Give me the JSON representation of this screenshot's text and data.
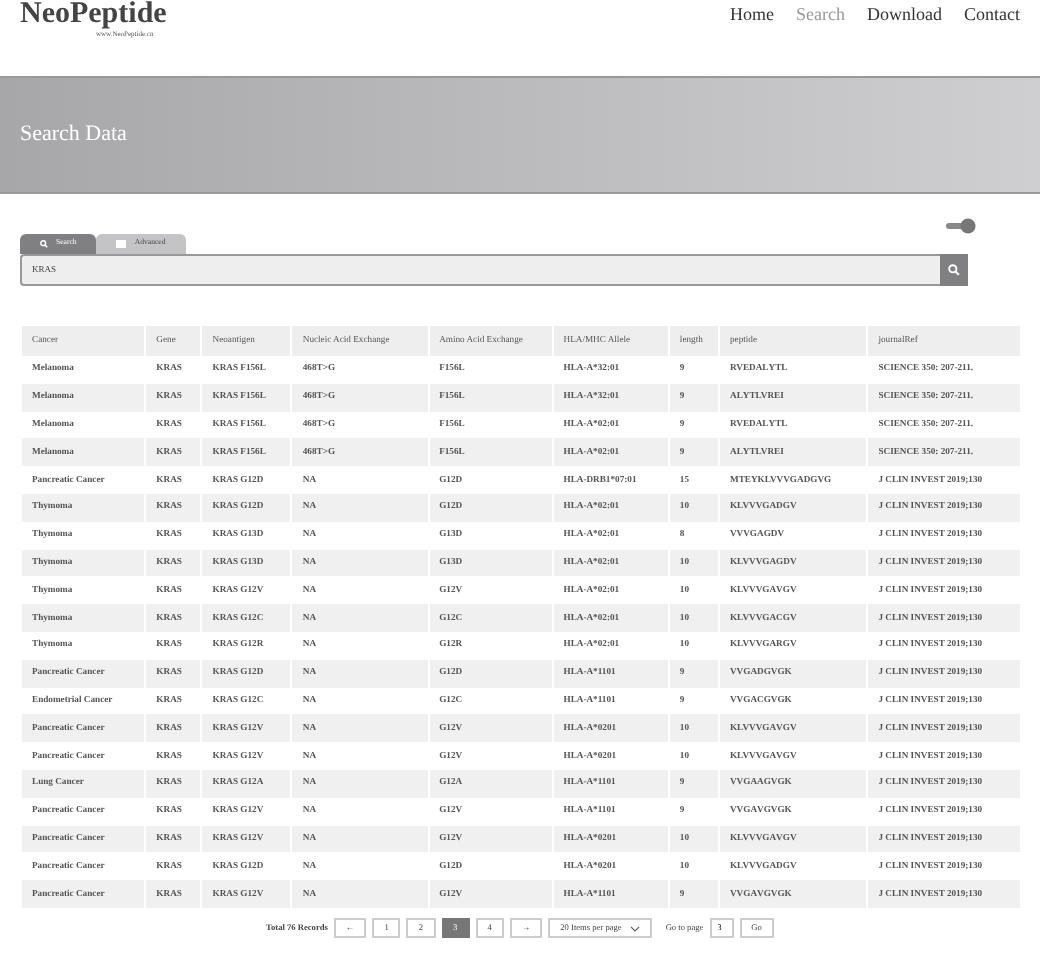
{
  "brand": {
    "title": "NeoPeptide",
    "subtitle": "www.NeoPeptide.cn"
  },
  "nav": [
    {
      "label": "Home",
      "selected": false
    },
    {
      "label": "Search",
      "selected": true
    },
    {
      "label": "Download",
      "selected": false
    },
    {
      "label": "Contact",
      "selected": false
    }
  ],
  "banner": {
    "title": "Search Data"
  },
  "switch": {
    "on": true
  },
  "tabs": [
    {
      "label": "Search",
      "selected": true,
      "kind": "search"
    },
    {
      "label": "Advanced",
      "selected": false,
      "kind": "table"
    }
  ],
  "search": {
    "value": "KRAS"
  },
  "table": {
    "columns": [
      "Cancer",
      "Gene",
      "Neoantigen",
      "Nucleic Acid Exchange",
      "Amino Acid Exchange",
      "HLA/MHC Allele",
      "length",
      "peptide",
      "journalRef"
    ],
    "rows": [
      [
        "Melanoma",
        "KRAS",
        "KRAS F156L",
        "468T>G",
        "F156L",
        "HLA-A*32:01",
        "9",
        "RVEDA**L**YTL",
        "SCIENCE 350: 207-211."
      ],
      [
        "Melanoma",
        "KRAS",
        "KRAS F156L",
        "468T>G",
        "F156L",
        "HLA-A*32:01",
        "9",
        "A**L**YTLVREI",
        "SCIENCE 350: 207-211."
      ],
      [
        "Melanoma",
        "KRAS",
        "KRAS F156L",
        "468T>G",
        "F156L",
        "HLA-A*02:01",
        "9",
        "RVEDA**L**YTL",
        "SCIENCE 350: 207-211."
      ],
      [
        "Melanoma",
        "KRAS",
        "KRAS F156L",
        "468T>G",
        "F156L",
        "HLA-A*02:01",
        "9",
        "A**L**YTLVREI",
        "SCIENCE 350: 207-211."
      ],
      [
        "Pancreatic Cancer",
        "KRAS",
        "KRAS G12D",
        "NA",
        "G12D",
        "HLA-DRB1*07:01",
        "15",
        "MTEYKLVVVGA**D**GVG",
        "J CLIN INVEST 2019;130"
      ],
      [
        "Thymoma",
        "KRAS",
        "KRAS G12D",
        "NA",
        "G12D",
        "HLA-A*02:01",
        "10",
        "KLVVVGA**D**GV",
        "J CLIN INVEST 2019;130"
      ],
      [
        "Thymoma",
        "KRAS",
        "KRAS G13D",
        "NA",
        "G13D",
        "HLA-A*02:01",
        "8",
        "VVVGAG**D**V",
        "J CLIN INVEST 2019;130"
      ],
      [
        "Thymoma",
        "KRAS",
        "KRAS G13D",
        "NA",
        "G13D",
        "HLA-A*02:01",
        "10",
        "KLVVVGAG**D**V",
        "J CLIN INVEST 2019;130"
      ],
      [
        "Thymoma",
        "KRAS",
        "KRAS G12V",
        "NA",
        "G12V",
        "HLA-A*02:01",
        "10",
        "KLVVVGA**V**GV",
        "J CLIN INVEST 2019;130"
      ],
      [
        "Thymoma",
        "KRAS",
        "KRAS G12C",
        "NA",
        "G12C",
        "HLA-A*02:01",
        "10",
        "KLVVVGA**C**GV",
        "J CLIN INVEST 2019;130"
      ],
      [
        "Thymoma",
        "KRAS",
        "KRAS G12R",
        "NA",
        "G12R",
        "HLA-A*02:01",
        "10",
        "KLVVVGA**R**GV",
        "J CLIN INVEST 2019;130"
      ],
      [
        "Pancreatic Cancer",
        "KRAS",
        "KRAS G12D",
        "NA",
        "G12D",
        "HLA-A*1101",
        "9",
        "VVGA**D**GVGK",
        "J CLIN INVEST 2019;130"
      ],
      [
        "Endometrial Cancer",
        "KRAS",
        "KRAS G12C",
        "NA",
        "G12C",
        "HLA-A*1101",
        "9",
        "VVGA**C**GVGK",
        "J CLIN INVEST 2019;130"
      ],
      [
        "Pancreatic Cancer",
        "KRAS",
        "KRAS G12V",
        "NA",
        "G12V",
        "HLA-A*0201",
        "10",
        "KLVVVGA**V**GV",
        "J CLIN INVEST 2019;130"
      ],
      [
        "Pancreatic Cancer",
        "KRAS",
        "KRAS G12V",
        "NA",
        "G12V",
        "HLA-A*0201",
        "10",
        "KLVVVGA**V**GV",
        "J CLIN INVEST 2019;130"
      ],
      [
        "Lung Cancer",
        "KRAS",
        "KRAS G12A",
        "NA",
        "G12A",
        "HLA-A*1101",
        "9",
        "VVGA**A**GVGK",
        "J CLIN INVEST 2019;130"
      ],
      [
        "Pancreatic Cancer",
        "KRAS",
        "KRAS G12V",
        "NA",
        "G12V",
        "HLA-A*1101",
        "9",
        "VVGA**V**GVGK",
        "J CLIN INVEST 2019;130"
      ],
      [
        "Pancreatic Cancer",
        "KRAS",
        "KRAS G12V",
        "NA",
        "G12V",
        "HLA-A*0201",
        "10",
        "KLVVVGA**V**GV",
        "J CLIN INVEST 2019;130"
      ],
      [
        "Pancreatic Cancer",
        "KRAS",
        "KRAS G12D",
        "NA",
        "G12D",
        "HLA-A*0201",
        "10",
        "KLVVVGA**D**GV",
        "J CLIN INVEST 2019;130"
      ],
      [
        "Pancreatic Cancer",
        "KRAS",
        "KRAS G12V",
        "NA",
        "G12V",
        "HLA-A*1101",
        "9",
        "VVGA**V**GVGK",
        "J CLIN INVEST 2019;130"
      ]
    ]
  },
  "pagination": {
    "total": "Total 76 Records",
    "prev": "←",
    "pages": [
      {
        "label": "1",
        "selected": false
      },
      {
        "label": "2",
        "selected": false
      },
      {
        "label": "3",
        "selected": true
      },
      {
        "label": "4",
        "selected": false
      }
    ],
    "next": "→",
    "per_page": "20 Items per page",
    "goto_label": "Go to page",
    "goto_value": "3",
    "go": "Go"
  }
}
